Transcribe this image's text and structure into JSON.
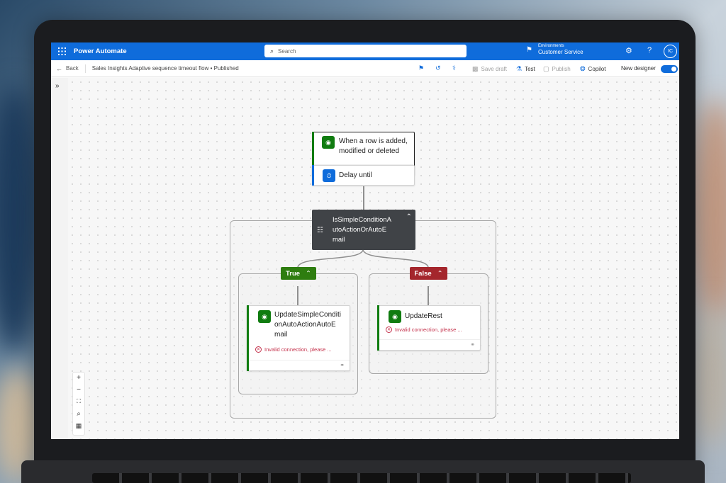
{
  "header": {
    "app_title": "Power Automate",
    "search_placeholder": "Search",
    "environment_label": "Environments",
    "environment_name": "Customer Service",
    "avatar_initials": "IC"
  },
  "commandbar": {
    "back_label": "Back",
    "flow_title": "Sales Insights Adaptive sequence timeout flow • Published",
    "save_draft": "Save draft",
    "test": "Test",
    "publish": "Publish",
    "copilot": "Copilot",
    "new_designer": "New designer",
    "new_designer_on": true
  },
  "flow": {
    "trigger": {
      "title_line1": "When a row is added,",
      "title_line2": "modified or deleted"
    },
    "delay": {
      "title": "Delay until"
    },
    "condition": {
      "title_line1": "IsSimpleConditionA",
      "title_line2": "utoActionOrAutoE",
      "title_line3": "mail"
    },
    "true_branch": {
      "label": "True",
      "action": {
        "title_line1": "UpdateSimpleConditi",
        "title_line2": "onAutoActionAutoE",
        "title_line3": "mail",
        "error": "Invalid connection, please ..."
      }
    },
    "false_branch": {
      "label": "False",
      "action": {
        "title": "UpdateRest",
        "error": "Invalid connection, please ..."
      }
    }
  },
  "zoom_controls": [
    "+",
    "−",
    "⛶",
    "⌕",
    "▦"
  ],
  "colors": {
    "brand_blue": "#0f6cdb",
    "dataverse_green": "#107c10",
    "true_green": "#107c10",
    "false_red": "#c4314b",
    "condition_dark": "#404347"
  }
}
